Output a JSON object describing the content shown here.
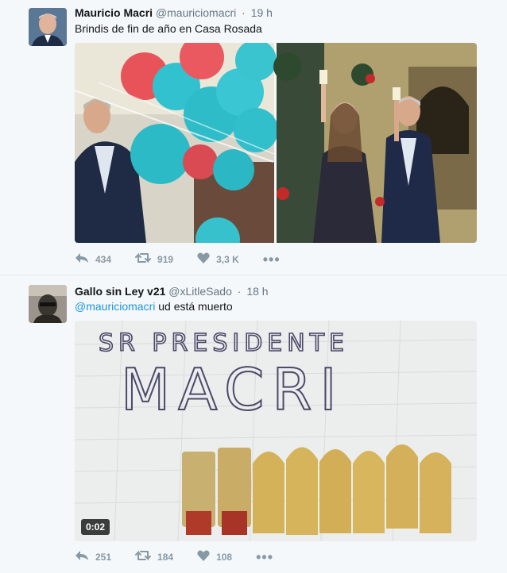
{
  "tweets": [
    {
      "name": "Mauricio Macri",
      "handle": "@mauriciomacri",
      "time": "19 h",
      "text": "Brindis de fin de año en Casa Rosada",
      "reply_count": "434",
      "retweet_count": "919",
      "like_count": "3,3 K"
    },
    {
      "name": "Gallo sin Ley v21",
      "handle": "@xLitleSado",
      "time": "18 h",
      "mention": "@mauriciomacri",
      "text": " ud está muerto",
      "video_duration": "0:02",
      "reply_count": "251",
      "retweet_count": "184",
      "like_count": "108",
      "handwriting_line1": "SR PRESIDENTE",
      "handwriting_line2": "MACRI"
    }
  ],
  "colors": {
    "background": "#f5f8fa",
    "link": "#1b95e0",
    "muted": "#8899a6",
    "name": "#14171a"
  },
  "icons": [
    "reply-icon",
    "retweet-icon",
    "heart-icon",
    "more-icon"
  ]
}
